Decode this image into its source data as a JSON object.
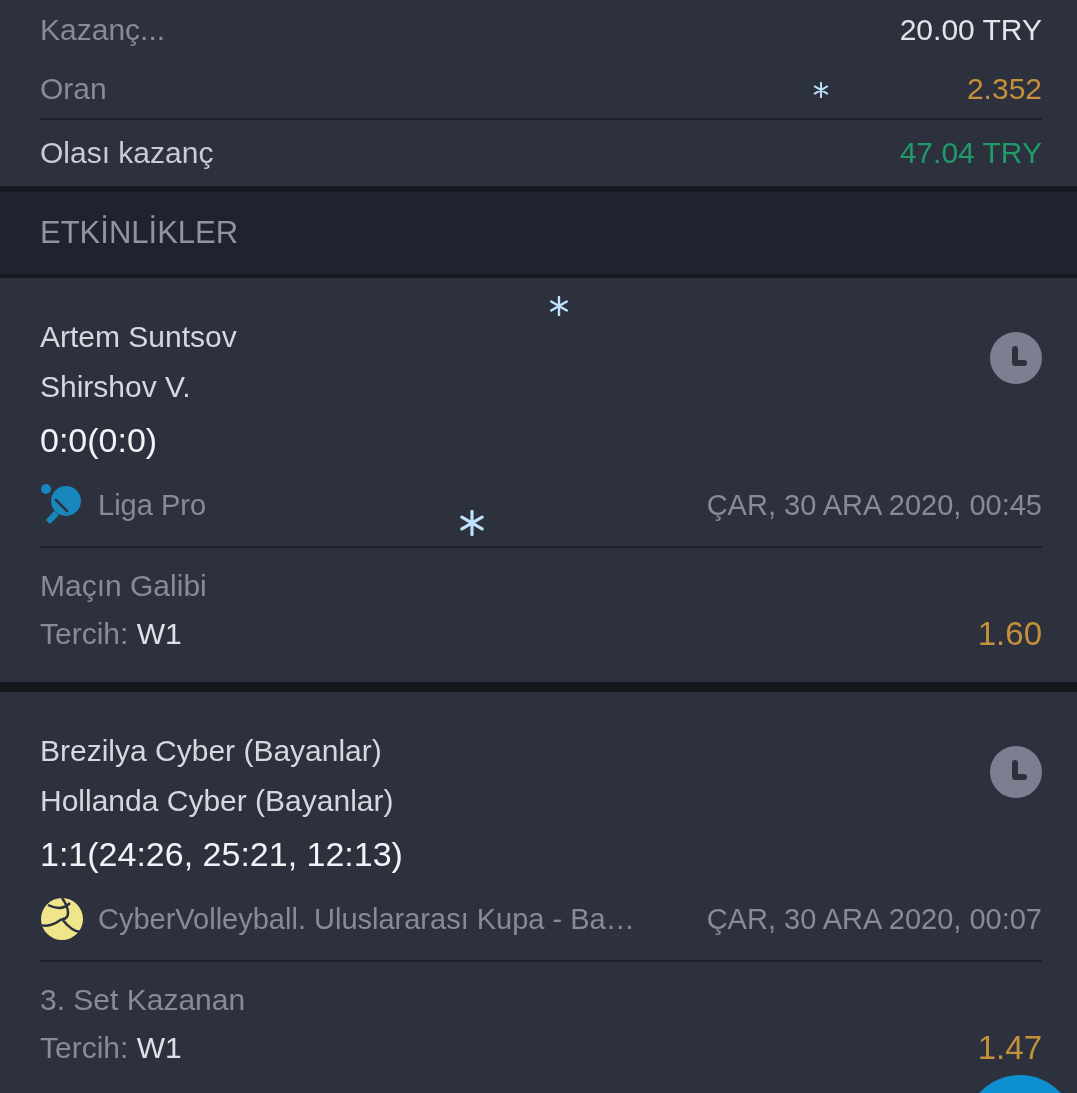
{
  "summary": [
    {
      "label": "Kazanç...",
      "value": "20.00 TRY",
      "kind": "plain"
    },
    {
      "label": "Oran",
      "value": "2.352",
      "kind": "odds"
    },
    {
      "label": "Olası kazanç",
      "value": "47.04 TRY",
      "kind": "win"
    }
  ],
  "section_title": "ETKİNLİKLER",
  "events": [
    {
      "team_1": "Artem Suntsov",
      "team_2": "Shirshov V.",
      "score": "0:0(0:0)",
      "kind": "table-tennis",
      "league": "Liga Pro",
      "date": "ÇAR, 30 ARA 2020, 00:45",
      "market": "Maçın Galibi",
      "pick_label": "Tercih:",
      "pick": "W1",
      "odds": "1.60"
    },
    {
      "team_1": "Brezilya Cyber (Bayanlar)",
      "team_2": "Hollanda Cyber (Bayanlar)",
      "score": "1:1(24:26, 25:21, 12:13)",
      "kind": "volleyball",
      "league": "CyberVolleyball. Uluslararası Kupa - Ba…",
      "date": "ÇAR, 30 ARA 2020, 00:07",
      "market": "3. Set Kazanan",
      "pick_label": "Tercih:",
      "pick": "W1",
      "odds": "1.47"
    }
  ]
}
